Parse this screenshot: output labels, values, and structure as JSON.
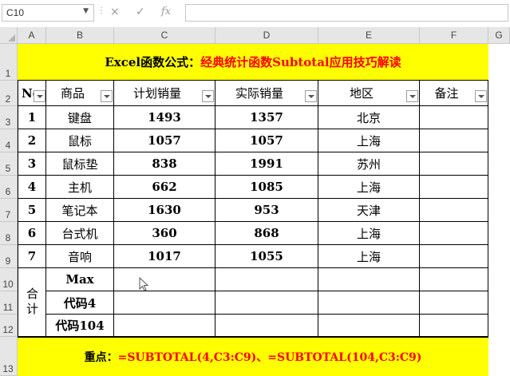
{
  "formula_bar": {
    "name_box": "C10",
    "cancel_glyph": "×",
    "enter_glyph": "✓",
    "fx_glyph": "fx",
    "formula": ""
  },
  "columns": [
    "A",
    "B",
    "C",
    "D",
    "E",
    "F",
    "G"
  ],
  "rows": [
    "1",
    "2",
    "3",
    "4",
    "5",
    "6",
    "7",
    "8",
    "9",
    "10",
    "11",
    "12",
    "13"
  ],
  "title": {
    "part1": "Excel函数公式：",
    "part2": "经典统计函数Subtotal应用技巧解读"
  },
  "headers": [
    "No",
    "商品",
    "计划销量",
    "实际销量",
    "地区",
    "备注"
  ],
  "data_rows": [
    {
      "no": "1",
      "product": "键盘",
      "plan": "1493",
      "actual": "1357",
      "region": "北京"
    },
    {
      "no": "2",
      "product": "鼠标",
      "plan": "1057",
      "actual": "1057",
      "region": "上海"
    },
    {
      "no": "3",
      "product": "鼠标垫",
      "plan": "838",
      "actual": "1991",
      "region": "苏州"
    },
    {
      "no": "4",
      "product": "主机",
      "plan": "662",
      "actual": "1085",
      "region": "上海"
    },
    {
      "no": "5",
      "product": "笔记本",
      "plan": "1630",
      "actual": "953",
      "region": "天津"
    },
    {
      "no": "6",
      "product": "台式机",
      "plan": "360",
      "actual": "868",
      "region": "上海"
    },
    {
      "no": "7",
      "product": "音响",
      "plan": "1017",
      "actual": "1055",
      "region": "上海"
    }
  ],
  "summary": {
    "label": "合计",
    "items": [
      "Max",
      "代码4",
      "代码104"
    ]
  },
  "note": {
    "part1": "重点：",
    "part2": "=SUBTOTAL(4,C3:C9)、=SUBTOTAL(104,C3:C9)"
  },
  "colors": {
    "highlight": "#ffff00",
    "accent": "#ff0000"
  }
}
